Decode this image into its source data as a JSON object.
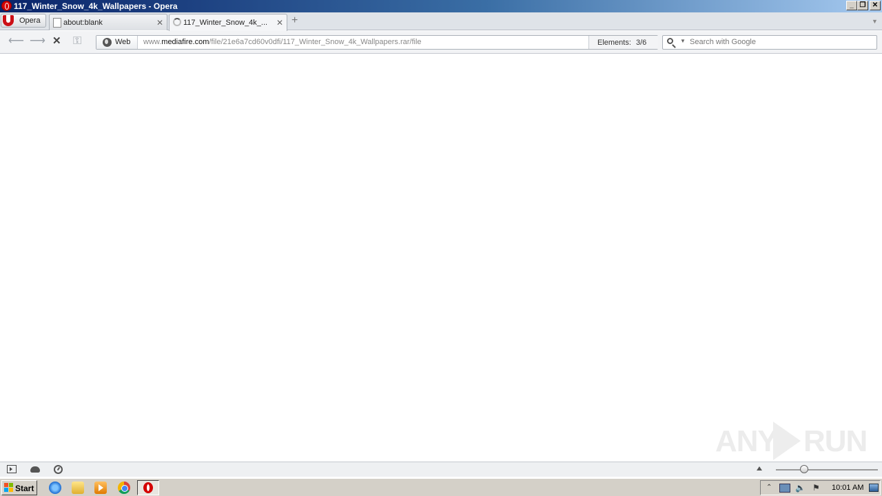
{
  "window": {
    "title": "117_Winter_Snow_4k_Wallpapers - Opera",
    "min_label": "_",
    "max_label": "❐",
    "close_label": "✕"
  },
  "menu": {
    "opera_label": "Opera"
  },
  "tabs": [
    {
      "title": "about:blank",
      "close": "✕"
    },
    {
      "title": "117_Winter_Snow_4k_...",
      "close": "✕"
    }
  ],
  "new_tab_label": "+",
  "nav": {
    "back": "⟵",
    "forward": "⟶",
    "stop": "✕",
    "key": "⚿"
  },
  "address": {
    "badge": "Web",
    "url_prefix": "www.",
    "url_host": "mediafire.com",
    "url_path": "/file/21e6a7cd60v0dfi/117_Winter_Snow_4k_Wallpapers.rar/file",
    "elements_label": "Elements:",
    "elements_value": "3/6"
  },
  "search": {
    "placeholder": "Search with Google"
  },
  "watermark": {
    "left": "ANY",
    "right": "RUN"
  },
  "taskbar": {
    "start_label": "Start",
    "clock": "10:01 AM",
    "tray_up": "⌃",
    "tray_vol": "🔈",
    "tray_flag": "⚑"
  }
}
